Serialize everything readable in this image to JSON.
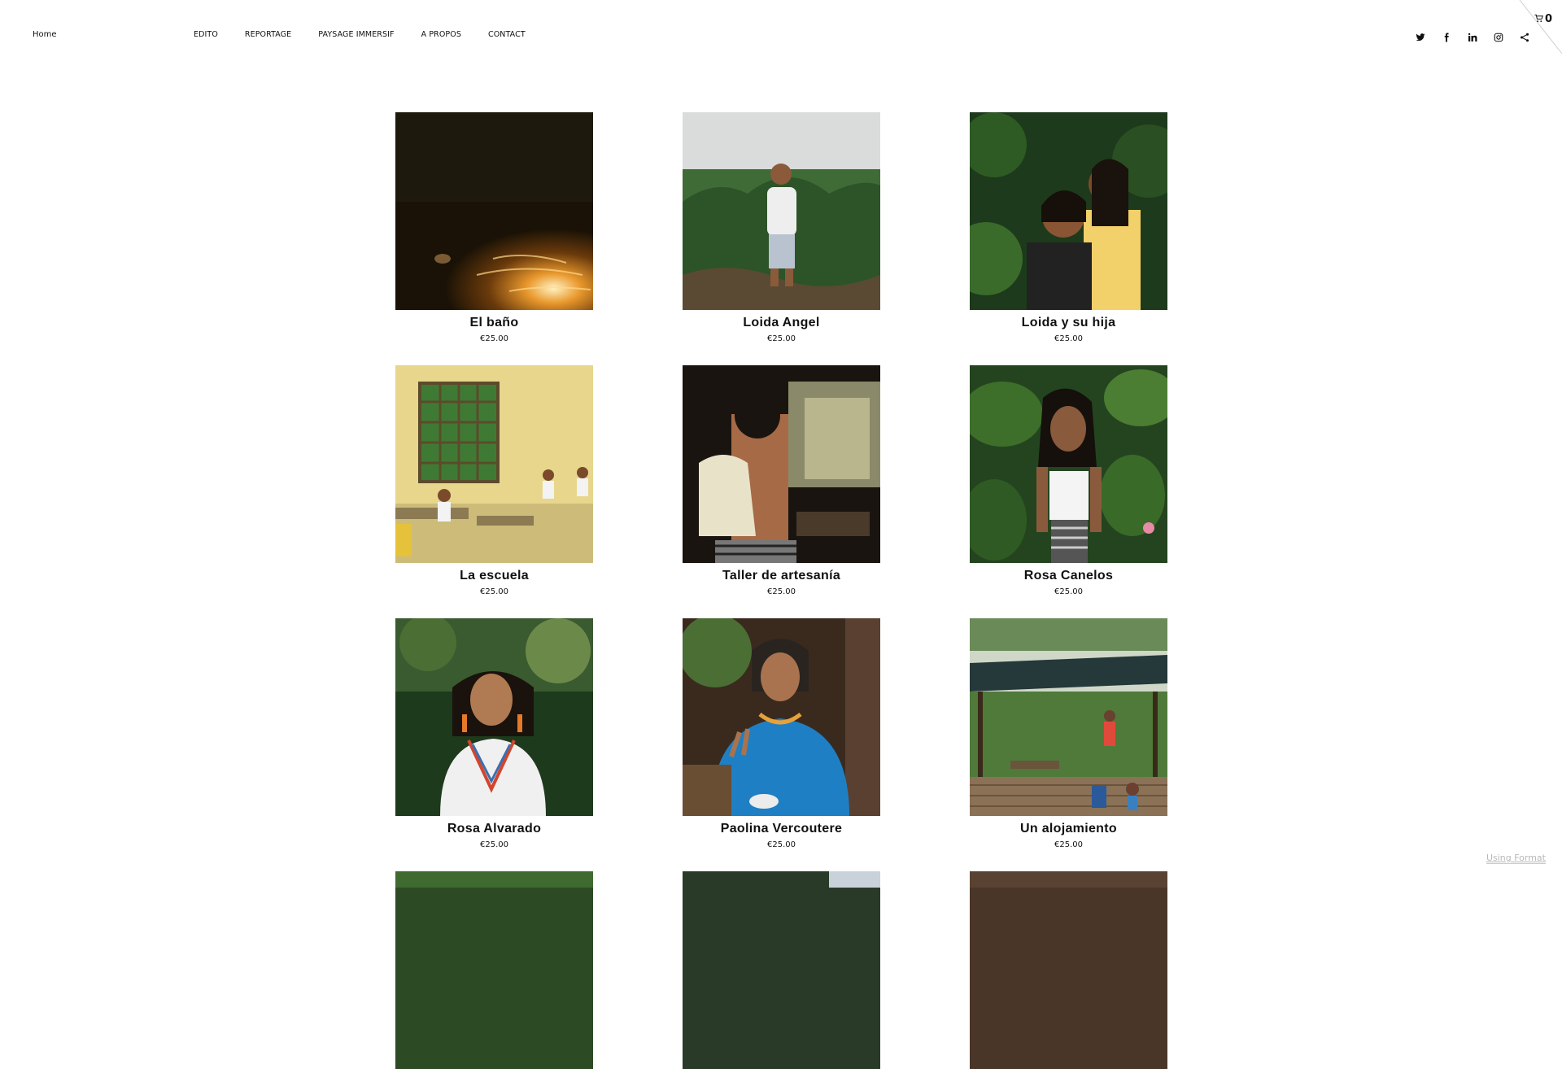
{
  "header": {
    "home": "Home",
    "nav": [
      "EDITO",
      "REPORTAGE",
      "PAYSAGE IMMERSIF",
      "A PROPOS",
      "CONTACT"
    ],
    "social": [
      "twitter-icon",
      "facebook-icon",
      "linkedin-icon",
      "instagram-icon",
      "share-icon"
    ],
    "cart_count": "0"
  },
  "products": [
    {
      "title": "El baño",
      "price": "€25.00",
      "image": "night-river-swimmer"
    },
    {
      "title": "Loida Angel",
      "price": "€25.00",
      "image": "woman-standing-in-jungle"
    },
    {
      "title": "Loida y su hija",
      "price": "€25.00",
      "image": "mother-and-daughter"
    },
    {
      "title": "La escuela",
      "price": "€25.00",
      "image": "children-in-classroom"
    },
    {
      "title": "Taller de artesanía",
      "price": "€25.00",
      "image": "woman-crafting"
    },
    {
      "title": "Rosa Canelos",
      "price": "€25.00",
      "image": "woman-among-leaves"
    },
    {
      "title": "Rosa Alvarado",
      "price": "€25.00",
      "image": "woman-looking-up"
    },
    {
      "title": "Paolina Vercoutere",
      "price": "€25.00",
      "image": "woman-in-blue-shawl"
    },
    {
      "title": "Un alojamiento",
      "price": "€25.00",
      "image": "wooden-shelter"
    }
  ],
  "footer": {
    "using": "Using Format"
  }
}
